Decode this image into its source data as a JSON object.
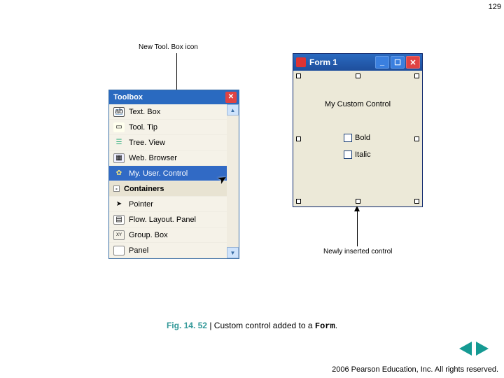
{
  "page_number": "129",
  "annotations": {
    "toolbox_icon": "New Tool. Box icon",
    "newly_inserted": "Newly inserted control"
  },
  "toolbox": {
    "title": "Toolbox",
    "items": [
      {
        "label": "Text. Box"
      },
      {
        "label": "Tool. Tip"
      },
      {
        "label": "Tree. View"
      },
      {
        "label": "Web. Browser"
      },
      {
        "label": "My. User. Control"
      },
      {
        "label": "Containers"
      },
      {
        "label": "Pointer"
      },
      {
        "label": "Flow. Layout. Panel"
      },
      {
        "label": "Group. Box"
      },
      {
        "label": "Panel"
      }
    ],
    "group_toggle": "-"
  },
  "form1": {
    "title": "Form 1",
    "custom_label": "My Custom Control",
    "bold_label": "Bold",
    "italic_label": "Italic"
  },
  "caption": {
    "fig": "Fig. 14. 52",
    "sep": " | ",
    "text": "Custom control added to a ",
    "form_word": "Form",
    "period": "."
  },
  "copyright": "  2006 Pearson Education, Inc.  All rights reserved."
}
